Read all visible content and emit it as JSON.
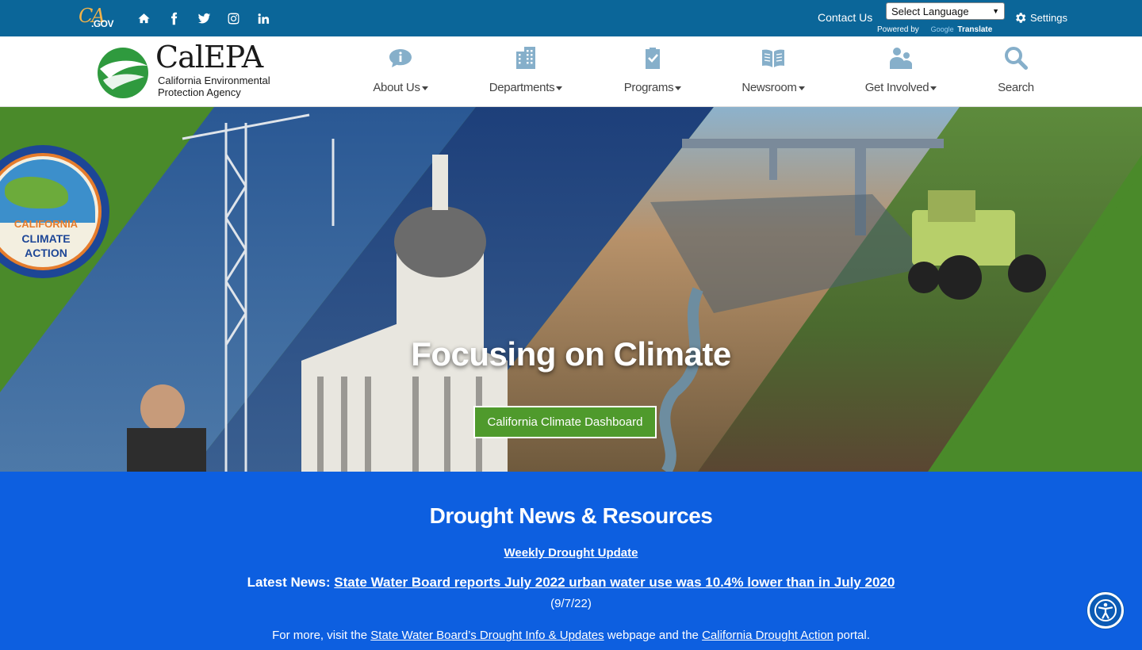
{
  "utility_bar": {
    "cagov": {
      "ca": "CA",
      "gov": ".GOV"
    },
    "social": [
      "home-icon",
      "facebook-icon",
      "twitter-icon",
      "instagram-icon",
      "linkedin-icon"
    ],
    "contact_us": "Contact Us",
    "language_select": "Select Language",
    "powered_by": "Powered by",
    "google": "Google",
    "translate": "Translate",
    "settings": "Settings"
  },
  "header": {
    "logo": {
      "name": "CalEPA",
      "subtitle_line1": "California Environmental",
      "subtitle_line2": "Protection Agency"
    },
    "nav": [
      {
        "label": "About Us",
        "icon": "info-bubble-icon"
      },
      {
        "label": "Departments",
        "icon": "building-icon"
      },
      {
        "label": "Programs",
        "icon": "clipboard-check-icon"
      },
      {
        "label": "Newsroom",
        "icon": "open-book-icon"
      },
      {
        "label": "Get Involved",
        "icon": "people-icon"
      },
      {
        "label": "Search",
        "icon": "search-icon"
      }
    ]
  },
  "hero": {
    "badge": {
      "line1": "CALIFORNIA",
      "line2": "CLIMATE",
      "line3": "ACTION"
    },
    "title": "Focusing on Climate",
    "button": "California Climate Dashboard",
    "colors": {
      "green": "#4f9a2c",
      "dark_blue": "#15346b"
    }
  },
  "drought": {
    "title": "Drought News & Resources",
    "weekly_link": "Weekly Drought Update",
    "latest_prefix": "Latest News:",
    "latest_link": "State Water Board reports July 2022 urban water use was 10.4% lower than in July 2020",
    "latest_date": "(9/7/22)",
    "more_prefix": "For more, visit the",
    "more_link1": "State Water Board’s Drought Info & Updates",
    "more_mid": "webpage and the",
    "more_link2": "California Drought Action",
    "more_suffix": "portal.",
    "background": "#0d5fe0"
  },
  "accessibility": {
    "icon": "accessibility-icon"
  }
}
